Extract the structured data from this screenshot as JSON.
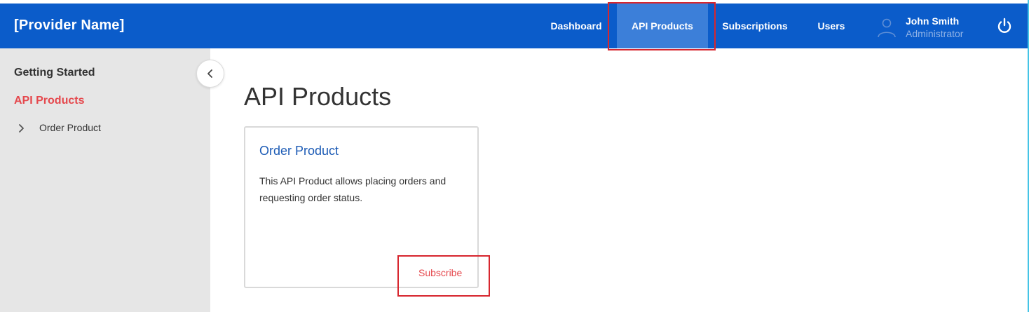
{
  "header": {
    "brand": "[Provider Name]",
    "nav": [
      {
        "label": "Dashboard",
        "active": false
      },
      {
        "label": "API Products",
        "active": true
      },
      {
        "label": "Subscriptions",
        "active": false
      },
      {
        "label": "Users",
        "active": false
      }
    ],
    "user": {
      "name": "John Smith",
      "role": "Administrator",
      "icon": "user-avatar-icon"
    },
    "power_icon": "power-icon"
  },
  "sidebar": {
    "heading": "Getting Started",
    "active_item": "API Products",
    "items": [
      {
        "label": "Order Product",
        "icon": "chevron-right-icon"
      }
    ],
    "collapse_icon": "chevron-left-icon"
  },
  "main": {
    "title": "API Products",
    "cards": [
      {
        "title": "Order Product",
        "description": "This API Product allows placing orders and requesting order status.",
        "action": "Subscribe"
      }
    ]
  },
  "colors": {
    "header_bg": "#0b5cca",
    "active_nav_bg": "#3c7fd9",
    "accent_red": "#e5484d",
    "highlight_border": "#d7262e",
    "link_blue": "#1c5bb5"
  }
}
